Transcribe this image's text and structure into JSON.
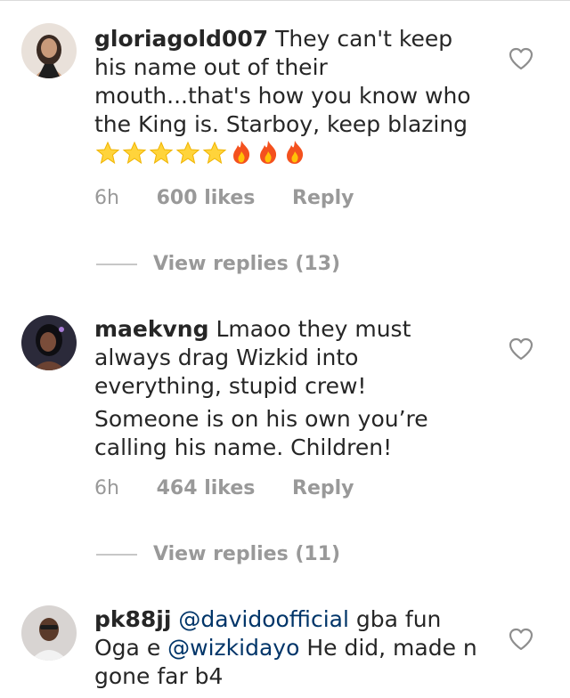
{
  "comments": [
    {
      "username": "gloriagold007",
      "text": "They can't keep his name out of their mouth...that's how you know who the King is. Starboy, keep blazing",
      "emojis": [
        "glowing-star",
        "glowing-star",
        "glowing-star",
        "glowing-star",
        "glowing-star",
        "fire",
        "fire",
        "fire"
      ],
      "time": "6h",
      "likes": "600 likes",
      "reply": "Reply",
      "view_replies": "View replies (13)"
    },
    {
      "username": "maekvng",
      "text": "Lmaoo they must always drag Wizkid into everything, stupid crew!",
      "text2": "Someone is on his own you’re calling his name. Children!",
      "time": "6h",
      "likes": "464 likes",
      "reply": "Reply",
      "view_replies": "View replies (11)"
    },
    {
      "username": "pk88jj",
      "mention1": "@davidoofficial",
      "text_a": "gba fun Oga e",
      "mention2": "@wizkidayo",
      "text_b": "He did, made n gone far b4"
    }
  ],
  "colors": {
    "mention": "#003569",
    "meta": "#999999",
    "text": "#262626"
  }
}
